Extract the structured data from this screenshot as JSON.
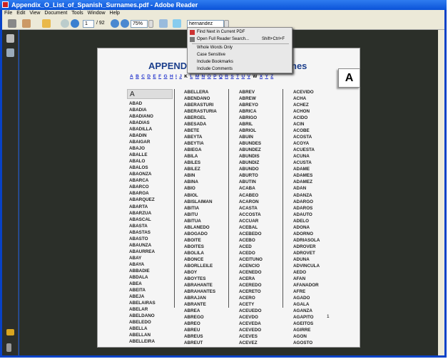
{
  "window": {
    "title": "Appendix_O_List_of_Spanish_Surnames.pdf - Adobe Reader"
  },
  "menu": [
    "File",
    "Edit",
    "View",
    "Document",
    "Tools",
    "Window",
    "Help"
  ],
  "toolbar": {
    "page_current": "1",
    "page_total": "/ 92",
    "zoom": "75%",
    "search_value": "hernandez"
  },
  "search_menu": {
    "find_next": "Find Next in Current PDF",
    "open_full": "Open Full Reader Search...",
    "open_full_shortcut": "Shift+Ctrl+F",
    "whole_words": "Whole Words Only",
    "case_sensitive": "Case Sensitive",
    "include_bookmarks": "Include Bookmarks",
    "include_comments": "Include Comments"
  },
  "page": {
    "heading_left": "APPEND",
    "heading_right": "nes",
    "letters": [
      "A",
      "B",
      "C",
      "D",
      "E",
      "F",
      "G",
      "H",
      "I",
      "J",
      "K",
      "L",
      "M",
      "N",
      "O",
      "P",
      "Q",
      "R",
      "S",
      "T",
      "U",
      "V",
      "W",
      "X",
      "Y",
      "Z"
    ],
    "current_letter_box": "A",
    "column_header": "A",
    "page_number": "1",
    "columns": [
      [
        "ABAD",
        "ABADIA",
        "ABADIANO",
        "ABADIAS",
        "ABADILLA",
        "ABADIN",
        "ABAIGAR",
        "ABAJO",
        "ABALLE",
        "ABALO",
        "ABALOS",
        "ABAONZA",
        "ABARCA",
        "ABARCO",
        "ABAROA",
        "ABARQUEZ",
        "ABARTA",
        "ABARZUA",
        "ABASCAL",
        "ABASTA",
        "ABASTAS",
        "ABASTO",
        "ABAUNZA",
        "ABAURREA",
        "ABAY",
        "ABAYA",
        "ABBADIE",
        "ABDALA",
        "ABEA",
        "ABEITA",
        "ABEJA",
        "ABELAIRAS",
        "ABELAR",
        "ABELDANO",
        "ABELEDO",
        "ABELLA",
        "ABELLAN",
        "ABELLEIRA"
      ],
      [
        "ABELLERA",
        "ABENDANO",
        "ABERASTURI",
        "ABERASTURIA",
        "ABERGEL",
        "ABESADA",
        "ABETE",
        "ABEYTA",
        "ABEYTIA",
        "ABIEGA",
        "ABILA",
        "ABILES",
        "ABILEZ",
        "ABIN",
        "ABINA",
        "ABIO",
        "ABIOL",
        "ABISLAIMAN",
        "ABITIA",
        "ABITU",
        "ABITUA",
        "ABLANEDO",
        "ABOGADO",
        "ABOITE",
        "ABOITES",
        "ABOLILA",
        "ABONCE",
        "ABORLLEILE",
        "ABOY",
        "ABOYTES",
        "ABRAHANTE",
        "ABRAHANTES",
        "ABRAJAN",
        "ABRANTE",
        "ABREA",
        "ABREGO",
        "ABREO",
        "ABREU",
        "ABREUS",
        "ABREUT"
      ],
      [
        "ABREV",
        "ABREW",
        "ABREYO",
        "ABRICA",
        "ABRIGO",
        "ABRIL",
        "ABRIOL",
        "ABUIN",
        "ABUNDES",
        "ABUNDEZ",
        "ABUNDIS",
        "ABUNDIZ",
        "ABUNDO",
        "ABURTO",
        "ABUTIN",
        "ACABA",
        "ACABEO",
        "ACARON",
        "ACASTA",
        "ACCOSTA",
        "ACCUAR",
        "ACEBAL",
        "ACEBEDO",
        "ACEBO",
        "ACED",
        "ACEDO",
        "ACEITUNO",
        "ACENCIO",
        "ACENEDO",
        "ACERA",
        "ACEREDO",
        "ACERETO",
        "ACERO",
        "ACETY",
        "ACEUEDO",
        "ACEVDO",
        "ACEVEDA",
        "ACEVEDO",
        "ACEVES",
        "ACEVEZ"
      ],
      [
        "ACEVIDO",
        "ACHA",
        "ACHEZ",
        "ACHON",
        "ACIDO",
        "ACIN",
        "ACOBE",
        "ACOSTA",
        "ACOYA",
        "ACUESTA",
        "ACUNA",
        "ACUSTA",
        "ADAME",
        "ADAMES",
        "ADAMEZ",
        "ADAN",
        "ADANZA",
        "ADARGO",
        "ADAROS",
        "ADAUTO",
        "ADELO",
        "ADONA",
        "ADORNO",
        "ADRIASOLA",
        "ADROVER",
        "ADROVET",
        "ADUNA",
        "ADVINCULA",
        "AEDO",
        "AFAN",
        "AFANADOR",
        "AFRE",
        "AGADO",
        "AGALA",
        "AGANZA",
        "AGAPITO",
        "AGEITOS",
        "AGIRRE",
        "AGON",
        "AGOSTO"
      ]
    ]
  }
}
